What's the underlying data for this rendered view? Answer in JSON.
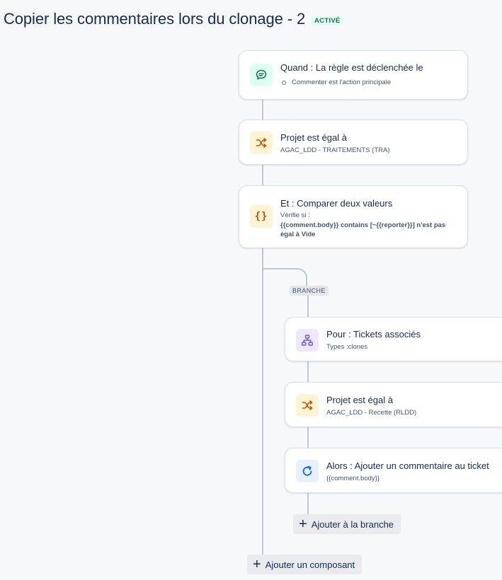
{
  "header": {
    "title": "Copier les commentaires lors du clonage - 2",
    "status": "ACTIVÉ"
  },
  "trigger": {
    "title": "Quand : La règle est déclenchée le",
    "detail": "Commenter est l'action principale",
    "icon": "comment-icon"
  },
  "condition_project": {
    "title": "Projet est égal à",
    "detail": "AGAC_LDD - TRAITEMENTS (TRA)",
    "icon": "shuffle-icon"
  },
  "condition_compare": {
    "title": "Et : Comparer deux valeurs",
    "verify_label": "Vérifie si :",
    "expression_line1": "{{comment.body}} contains [~{{reporter}}] n'est pas",
    "expression_line2": "égal à Vide",
    "icon": "braces-icon"
  },
  "branch": {
    "label": "BRANCHE",
    "for_each": {
      "title": "Pour : Tickets associés",
      "detail": "Types :clones",
      "icon": "hierarchy-icon"
    },
    "project": {
      "title": "Projet est égal à",
      "detail": "AGAC_LDD - Recette (RLDD)",
      "icon": "shuffle-icon"
    },
    "action": {
      "title": "Alors : Ajouter un commentaire au ticket",
      "detail": "{{comment.body}}",
      "icon": "refresh-icon"
    },
    "add_label": "Ajouter à la branche"
  },
  "add_component_label": "Ajouter un composant",
  "colors": {
    "accent_green": "#216e4e",
    "accent_orange": "#c25100",
    "accent_purple": "#6e5dc6",
    "accent_blue": "#0c66e4",
    "connector": "#c1c7d0"
  }
}
